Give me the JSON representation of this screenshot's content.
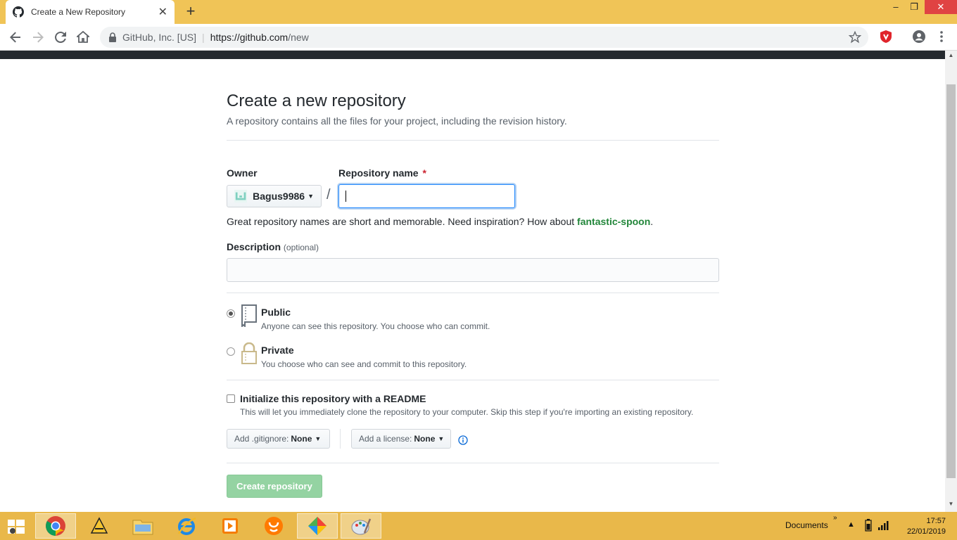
{
  "browser": {
    "tab_title": "Create a New Repository",
    "site_identity": "GitHub, Inc. [US]",
    "url_host": "https://github.com",
    "url_path": "/new"
  },
  "page": {
    "title": "Create a new repository",
    "subtitle": "A repository contains all the files for your project, including the revision history.",
    "owner_label": "Owner",
    "owner_value": "Bagus9986",
    "repo_name_label": "Repository name",
    "required_mark": "*",
    "repo_name_value": "",
    "slash": "/",
    "hint_prefix": "Great repository names are short and memorable. Need inspiration? How about",
    "hint_suggestion": "fantastic-spoon",
    "hint_suffix": ".",
    "description_label": "Description",
    "description_optional": "(optional)",
    "description_value": "",
    "visibility": [
      {
        "title": "Public",
        "note": "Anyone can see this repository. You choose who can commit.",
        "checked": true
      },
      {
        "title": "Private",
        "note": "You choose who can see and commit to this repository.",
        "checked": false
      }
    ],
    "readme_title": "Initialize this repository with a README",
    "readme_note": "This will let you immediately clone the repository to your computer. Skip this step if you're importing an existing repository.",
    "gitignore_label": "Add .gitignore:",
    "gitignore_value": "None",
    "license_label": "Add a license:",
    "license_value": "None",
    "create_button": "Create repository"
  },
  "taskbar": {
    "documents_label": "Documents",
    "time": "17:57",
    "date": "22/01/2019"
  },
  "colors": {
    "chrome_frame": "#f0c457",
    "taskbar": "#e9b84a",
    "create_button": "#94d3a2",
    "focus_ring": "#2188ff"
  }
}
